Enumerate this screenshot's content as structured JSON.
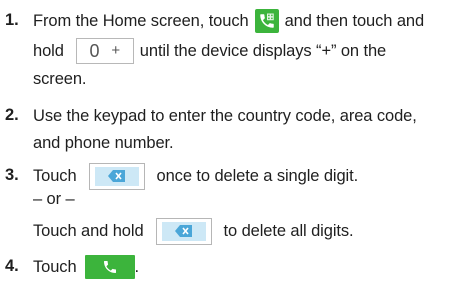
{
  "steps": [
    {
      "number": "1.",
      "lines": [
        {
          "before": "From the Home screen, touch",
          "after": "and then touch and"
        },
        {
          "before": "hold",
          "after": "until the device displays “+” on the"
        },
        {
          "text": "screen."
        }
      ],
      "icons": {
        "phone": "phone-icon",
        "zero_key": {
          "zero": "0",
          "plus": "+"
        }
      }
    },
    {
      "number": "2.",
      "lines": [
        {
          "text": "Use the keypad to enter the country code, area code,"
        },
        {
          "text": "and phone number."
        }
      ]
    },
    {
      "number": "3.",
      "lines": [
        {
          "before": "Touch",
          "after": "once to delete a single digit."
        },
        {
          "text": "– or –"
        },
        {
          "before": "Touch and hold",
          "after": "to delete all digits."
        }
      ],
      "icons": {
        "delete": "delete-icon"
      }
    },
    {
      "number": "4.",
      "lines": [
        {
          "before": "Touch",
          "after": "."
        }
      ],
      "icons": {
        "call": "call-icon"
      }
    }
  ],
  "colors": {
    "green": "#3cb43c",
    "delete_fill": "#cde8f6",
    "delete_glyph": "#4aa6d8",
    "key_border": "#b8b8b8"
  }
}
